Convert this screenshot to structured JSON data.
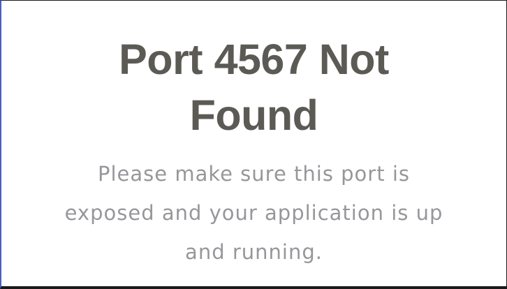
{
  "page": {
    "title": "Port 4567 Not Found",
    "message": "Please make sure this port is exposed and your application is up and running."
  },
  "colors": {
    "title_text": "#5c5a55",
    "message_text": "#98969a",
    "background": "#ffffff",
    "left_accent": "#4a5fc1"
  }
}
